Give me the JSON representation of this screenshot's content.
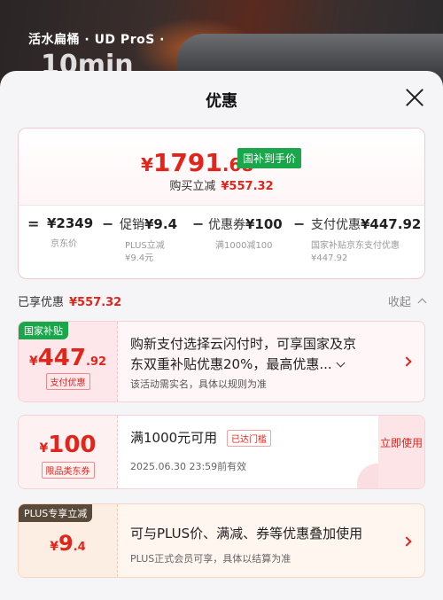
{
  "banner": {
    "subtitle": "活水扁桶 · UD ProS ·",
    "headline": "10min"
  },
  "sheet": {
    "title": "优惠"
  },
  "summary": {
    "yen": "¥",
    "price_int": "1791",
    "price_dec": ".68",
    "price_tag": "国补到手价",
    "saved_label": "购买立减",
    "saved_amount": "¥557.32",
    "formula": [
      {
        "op": "=",
        "label": "",
        "value": "¥2349",
        "sub1": "京东价",
        "sub2": ""
      },
      {
        "op": "−",
        "label": "促销",
        "value": "¥9.4",
        "sub1": "PLUS立减",
        "sub2": "¥9.4元"
      },
      {
        "op": "−",
        "label": "优惠券",
        "value": "¥100",
        "sub1": "满1000减100",
        "sub2": ""
      },
      {
        "op": "−",
        "label": "支付优惠",
        "value": "¥447.92",
        "sub1": "国家补贴京东支付优惠",
        "sub2": "¥447.92"
      }
    ]
  },
  "enjoyed": {
    "label": "已享优惠",
    "amount": "¥557.32",
    "collapse": "收起"
  },
  "cards": {
    "c1": {
      "corner": "国家补贴",
      "yen": "¥",
      "int": "447",
      "dec": ".92",
      "tag": "支付优惠",
      "line1": "购新支付选择云闪付时，可享国家及京",
      "line2": "东双重补贴优惠20%，最高优惠...",
      "note": "该活动需实名，具体以规则为准"
    },
    "c2": {
      "yen": "¥",
      "int": "100",
      "tag": "限品类东券",
      "title": "满1000元可用",
      "badge": "已达门槛",
      "date": "2025.06.30  23:59前有效",
      "claim": "立即使用"
    },
    "c3": {
      "corner": "PLUS专享立减",
      "yen": "¥",
      "int": "9",
      "dec": ".4",
      "title": "可与PLUS价、满减、券等优惠叠加使用",
      "note": "PLUS正式会员可享，具体以结算为准"
    }
  },
  "colors": {
    "accent": "#e1251b",
    "green": "#1aa64b",
    "plus": "#5a4a3a"
  }
}
